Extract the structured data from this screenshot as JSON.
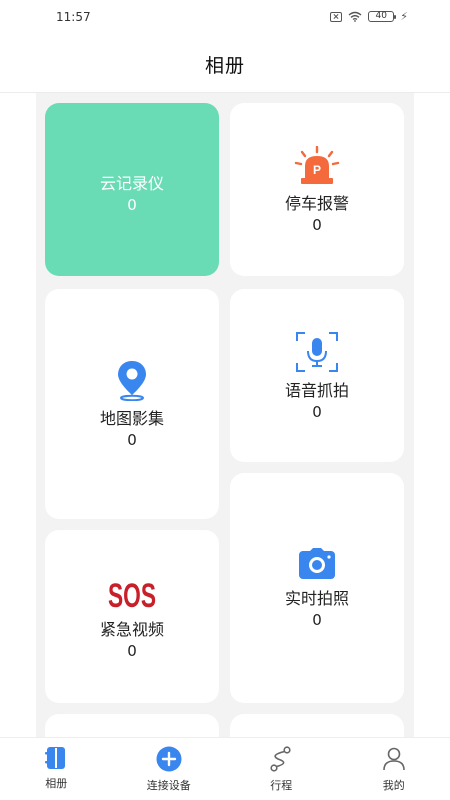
{
  "status_bar": {
    "time": "11:57",
    "battery": "40"
  },
  "header": {
    "title": "相册"
  },
  "albums": [
    {
      "label": "云记录仪",
      "count": "0",
      "icon": "cloud-recorder",
      "highlight": true
    },
    {
      "label": "停车报警",
      "count": "0",
      "icon": "alarm-light-icon"
    },
    {
      "label": "地图影集",
      "count": "0",
      "icon": "map-pin-icon"
    },
    {
      "label": "语音抓拍",
      "count": "0",
      "icon": "microphone-icon"
    },
    {
      "label": "紧急视频",
      "count": "0",
      "icon": "sos-icon",
      "icon_text": "SOS"
    },
    {
      "label": "实时拍照",
      "count": "0",
      "icon": "camera-icon"
    }
  ],
  "nav": {
    "items": [
      {
        "label": "相册",
        "icon": "album-icon"
      },
      {
        "label": "连接设备",
        "icon": "plus-circle-icon"
      },
      {
        "label": "行程",
        "icon": "route-icon"
      },
      {
        "label": "我的",
        "icon": "person-icon"
      }
    ]
  },
  "colors": {
    "highlight_card": "#69dcb6",
    "accent_blue": "#3a86ef",
    "alarm_orange": "#f46a3c",
    "sos_red": "#c8202a",
    "background": "#f3f3f3"
  }
}
